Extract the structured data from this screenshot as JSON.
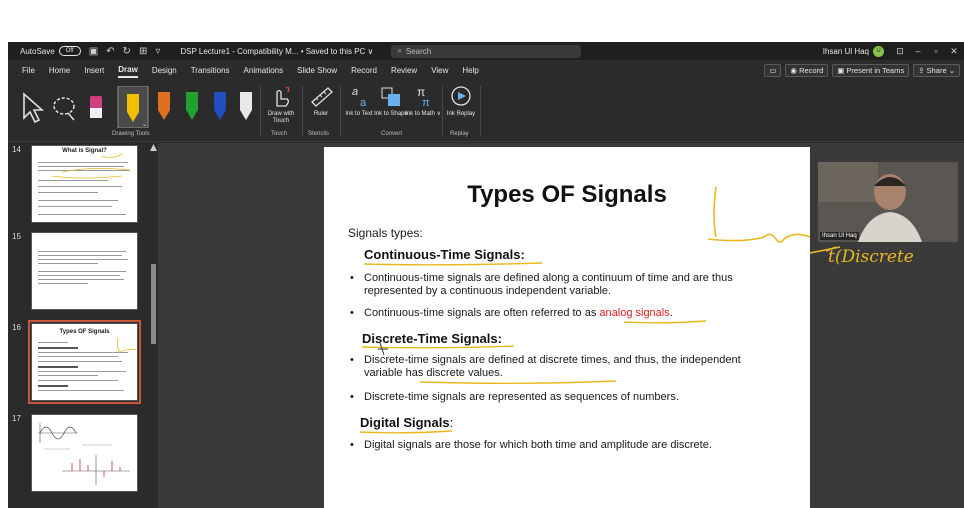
{
  "titlebar": {
    "autosave_label": "AutoSave",
    "autosave_state": "Off",
    "doc_title": "DSP Lecture1 - Compatibility M... • Saved to this PC ∨",
    "search_placeholder": "Search",
    "user_name": "Ihsan Ul Haq",
    "user_initial": "U"
  },
  "menubar": {
    "tabs": [
      "File",
      "Home",
      "Insert",
      "Draw",
      "Design",
      "Transitions",
      "Animations",
      "Slide Show",
      "Record",
      "Review",
      "View",
      "Help"
    ],
    "active_tab": "Draw",
    "record_label": "Record",
    "present_label": "Present in Teams",
    "share_label": "Share"
  },
  "ribbon": {
    "groups": {
      "drawing_tools": "Drawing Tools",
      "touch": "Touch",
      "stencils": "Stencils",
      "convert": "Convert",
      "replay": "Replay"
    },
    "buttons": {
      "draw_with_touch": "Draw with Touch",
      "ruler": "Ruler",
      "ink_to_text": "Ink to Text",
      "ink_to_shape": "Ink to Shape",
      "ink_to_math": "Ink to Math ∨",
      "ink_replay": "Ink Replay"
    },
    "pen_colors": [
      "#e8e8e8",
      "#f0a020",
      "#f0c000",
      "#e07020",
      "#22a030",
      "#2050c0",
      "#e8e8e8"
    ]
  },
  "thumbnails": [
    {
      "num": "14",
      "title": "What is Signal?"
    },
    {
      "num": "15",
      "title": ""
    },
    {
      "num": "16",
      "title": "Types OF Signals"
    },
    {
      "num": "17",
      "title": ""
    }
  ],
  "slide": {
    "title": "Types OF Signals",
    "intro": "Signals types:",
    "sections": [
      {
        "heading": "Continuous-Time Signals:",
        "bullets": [
          "Continuous-time signals are defined along a continuum of time and are thus represented by a continuous independent variable.",
          "Continuous-time signals are often referred to as"
        ],
        "highlight": "analog signals",
        "highlight_after": "."
      },
      {
        "heading": "Discrete-Time Signals:",
        "bullets": [
          "Discrete-time signals are defined at discrete times, and  thus, the independent variable has discrete values.",
          "Discrete-time signals are represented as sequences of numbers."
        ]
      },
      {
        "heading": "Digital Signals",
        "heading_suffix": ":",
        "bullets": [
          "Digital signals are those for which both time and amplitude are discrete."
        ]
      }
    ]
  },
  "annotation": {
    "handwriting": "t(Discrete",
    "ink_color": "#e8b820"
  },
  "camera": {
    "name": "Ihsan Ul Haq"
  }
}
